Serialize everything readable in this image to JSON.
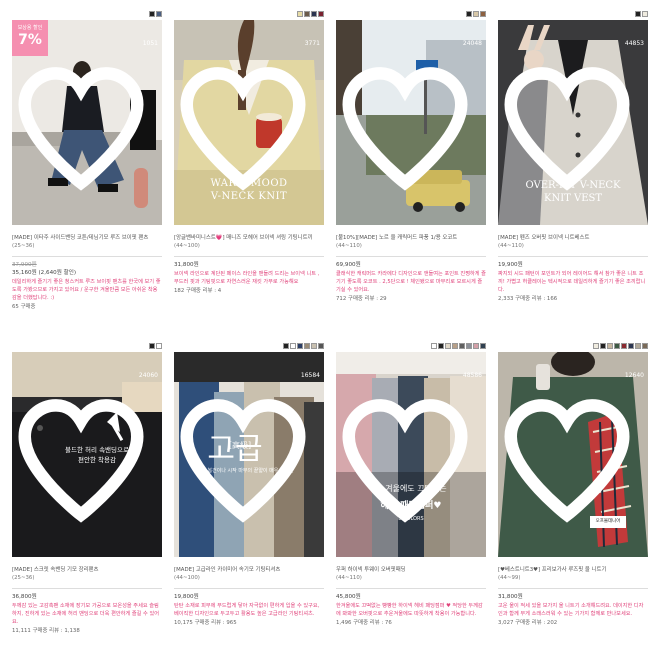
{
  "products": [
    {
      "likes": "1051",
      "badge_top": "보상용 할인",
      "badge_value": "7%",
      "name": "[MADE] 이타주 사이드밴딩 코튼/데님기모 루즈 브이핏 팬츠",
      "size": "(25~36)",
      "price_old": "37,900원",
      "price": "35,160원 (2,640원 할인)",
      "desc": "데일리하게 즐기기 좋은 청스커트 루즈 브이핏 팬츠를 한국에 보기 좋도록 가봤으므로 가지고 있어요 / 운구한 겨울만큼 모든 아쉬운 착용감을 더했답니다. :)",
      "meta": "65 구매중",
      "swatches": [
        "#222222",
        "#4a5e80"
      ]
    },
    {
      "likes": "3771",
      "name": "[앙글밴바미니스트💗] 매니즈 모헤어 브이넥 셔링 기팅니트끼",
      "size": "(44~100)",
      "price": "31,800원",
      "desc": "브이넥 라인으로 계단된 페이스 라인을 맨들려 드리는 브이넥 니트 , 부드러 핏과 기팅핏으로 자연스러운 재킷 가무로 가능해요",
      "meta": "182 구매중   리뷰 : 4",
      "overlay_line1": "WARM MOOD",
      "overlay_line2": "V-NECK KNIT",
      "swatches": [
        "#e7dca6",
        "#6b5b4b",
        "#2c3550",
        "#7a2230"
      ]
    },
    {
      "likes": "24048",
      "name": "[불10%][MADE] 노르 울 캐릭머드 파풍 1/용 오코트",
      "size": "(44~110)",
      "price": "69,900원",
      "desc": "클래식한 캐릭머드 카라에다 디자인으로 앤들여는 포인트 진쩡하게 즐기기 좋도록 오코트 . 2,5단으로 ! 체인됐으로 마무리로 모르시게 즐기실 수 있어요.",
      "meta": "712 구매중   리뷰 : 29",
      "swatches": [
        "#222222",
        "#d8c8a8",
        "#8c6040"
      ]
    },
    {
      "likes": "44853",
      "name": "[MADE] 펜즈 오버핏 브이넥 니트베스트",
      "size": "(44~110)",
      "price": "19,900원",
      "desc": "짜지되 시드 패턴이 포인트가 되어 레이어드 해서 참가 좋은 니트 조끼! 가볍고 허클레이는 텍시적으로 데일리하게 즐기기 좋은 조끼랍니다.",
      "meta": "2,333 구매중   리뷰 : 166",
      "overlay_line1": "OVER-FIT V-NECK",
      "overlay_line2": "KNIT VEST",
      "swatches": [
        "#222222",
        "#f0ece0"
      ]
    },
    {
      "likes": "24060",
      "name": "[MADE] 스크릿 속밴딩 기모 장리팬츠",
      "size": "(25~36)",
      "price": "36,800원",
      "desc": "두께감 있는 고감촉팬 소재에 장기모 가공으로 보온성을 주세요 슬림하지, 진하게 있는 소재에 허리 밴딩으로 더욱 편안하게 즐길 수 있어요.",
      "meta": "11,111 구매중   리뷰 : 1,138",
      "overlay_text1": "불드한 허리 속밴딩으로",
      "overlay_text2": "편안한 착용감",
      "swatches": [
        "#222222",
        "#ffffff"
      ]
    },
    {
      "likes": "16584",
      "name": "[MADE] 고급라인 카이미어 속기모 기팅티셔츠",
      "size": "(44~100)",
      "price": "19,800원",
      "desc": "탄탄 소재로 피부에 부드럽게 닿아 자극없이 편하게 입을 수 있구요, 베이직한 디자인으로 두고두고 활용도 높은 고급라인 기팅티셔츠.",
      "meta": "10,175 구매중   리뷰 : 965",
      "overlay_big": "고급",
      "overlay_small": "[高級]",
      "overlay_sub": ": 봄건이나 시작 마무의 끝얇이 매우 뛰어난",
      "swatches": [
        "#222222",
        "#ffffff",
        "#2b3e66",
        "#9a8c78",
        "#c8c0b0",
        "#555555"
      ]
    },
    {
      "likes": "48586",
      "name": "우퍼 하이넥 투웨이 오버핏패딩",
      "size": "(44~110)",
      "price": "45,800원",
      "desc": "한겨울에도 끄떡없는 빵빵한 하이넥 헤비 패딩점퍼 ♥ 적당한 두께감에 봐봐한 오버핏으로 추운겨울에도 따뜻하게 착용이 가능합니다.",
      "meta": "1,496 구매중   리뷰 : 76",
      "overlay_text1": "한 겨울에도 끄떡없는",
      "overlay_text2": "헤비 패딩점퍼♥",
      "overlay_text3": "8 COLORS",
      "swatches": [
        "#ffffff",
        "#222222",
        "#e0d8c8",
        "#b8a088",
        "#606060",
        "#8c9098",
        "#d4a0a8",
        "#304050"
      ]
    },
    {
      "likes": "12640",
      "name": "[♥베스트니트3♥] 프리보가사 루즈핏 울 니트기",
      "size": "(44~99)",
      "price": "31,800원",
      "desc": "고운 울이 적세 있을 보가지 울 니트기 소개해드려요. 데이지한 디자인과 함께 무게 소래스러워 수 있는 기가지 함께로 만나보세요.",
      "meta": "3,027 구매중   리뷰 : 202",
      "overlay_tag": "오프몰데니어",
      "swatches": [
        "#f0ece0",
        "#222222",
        "#c8b8a0",
        "#3e5a44",
        "#8a2a30",
        "#2c3550",
        "#b0a898",
        "#7a6a58"
      ]
    }
  ]
}
